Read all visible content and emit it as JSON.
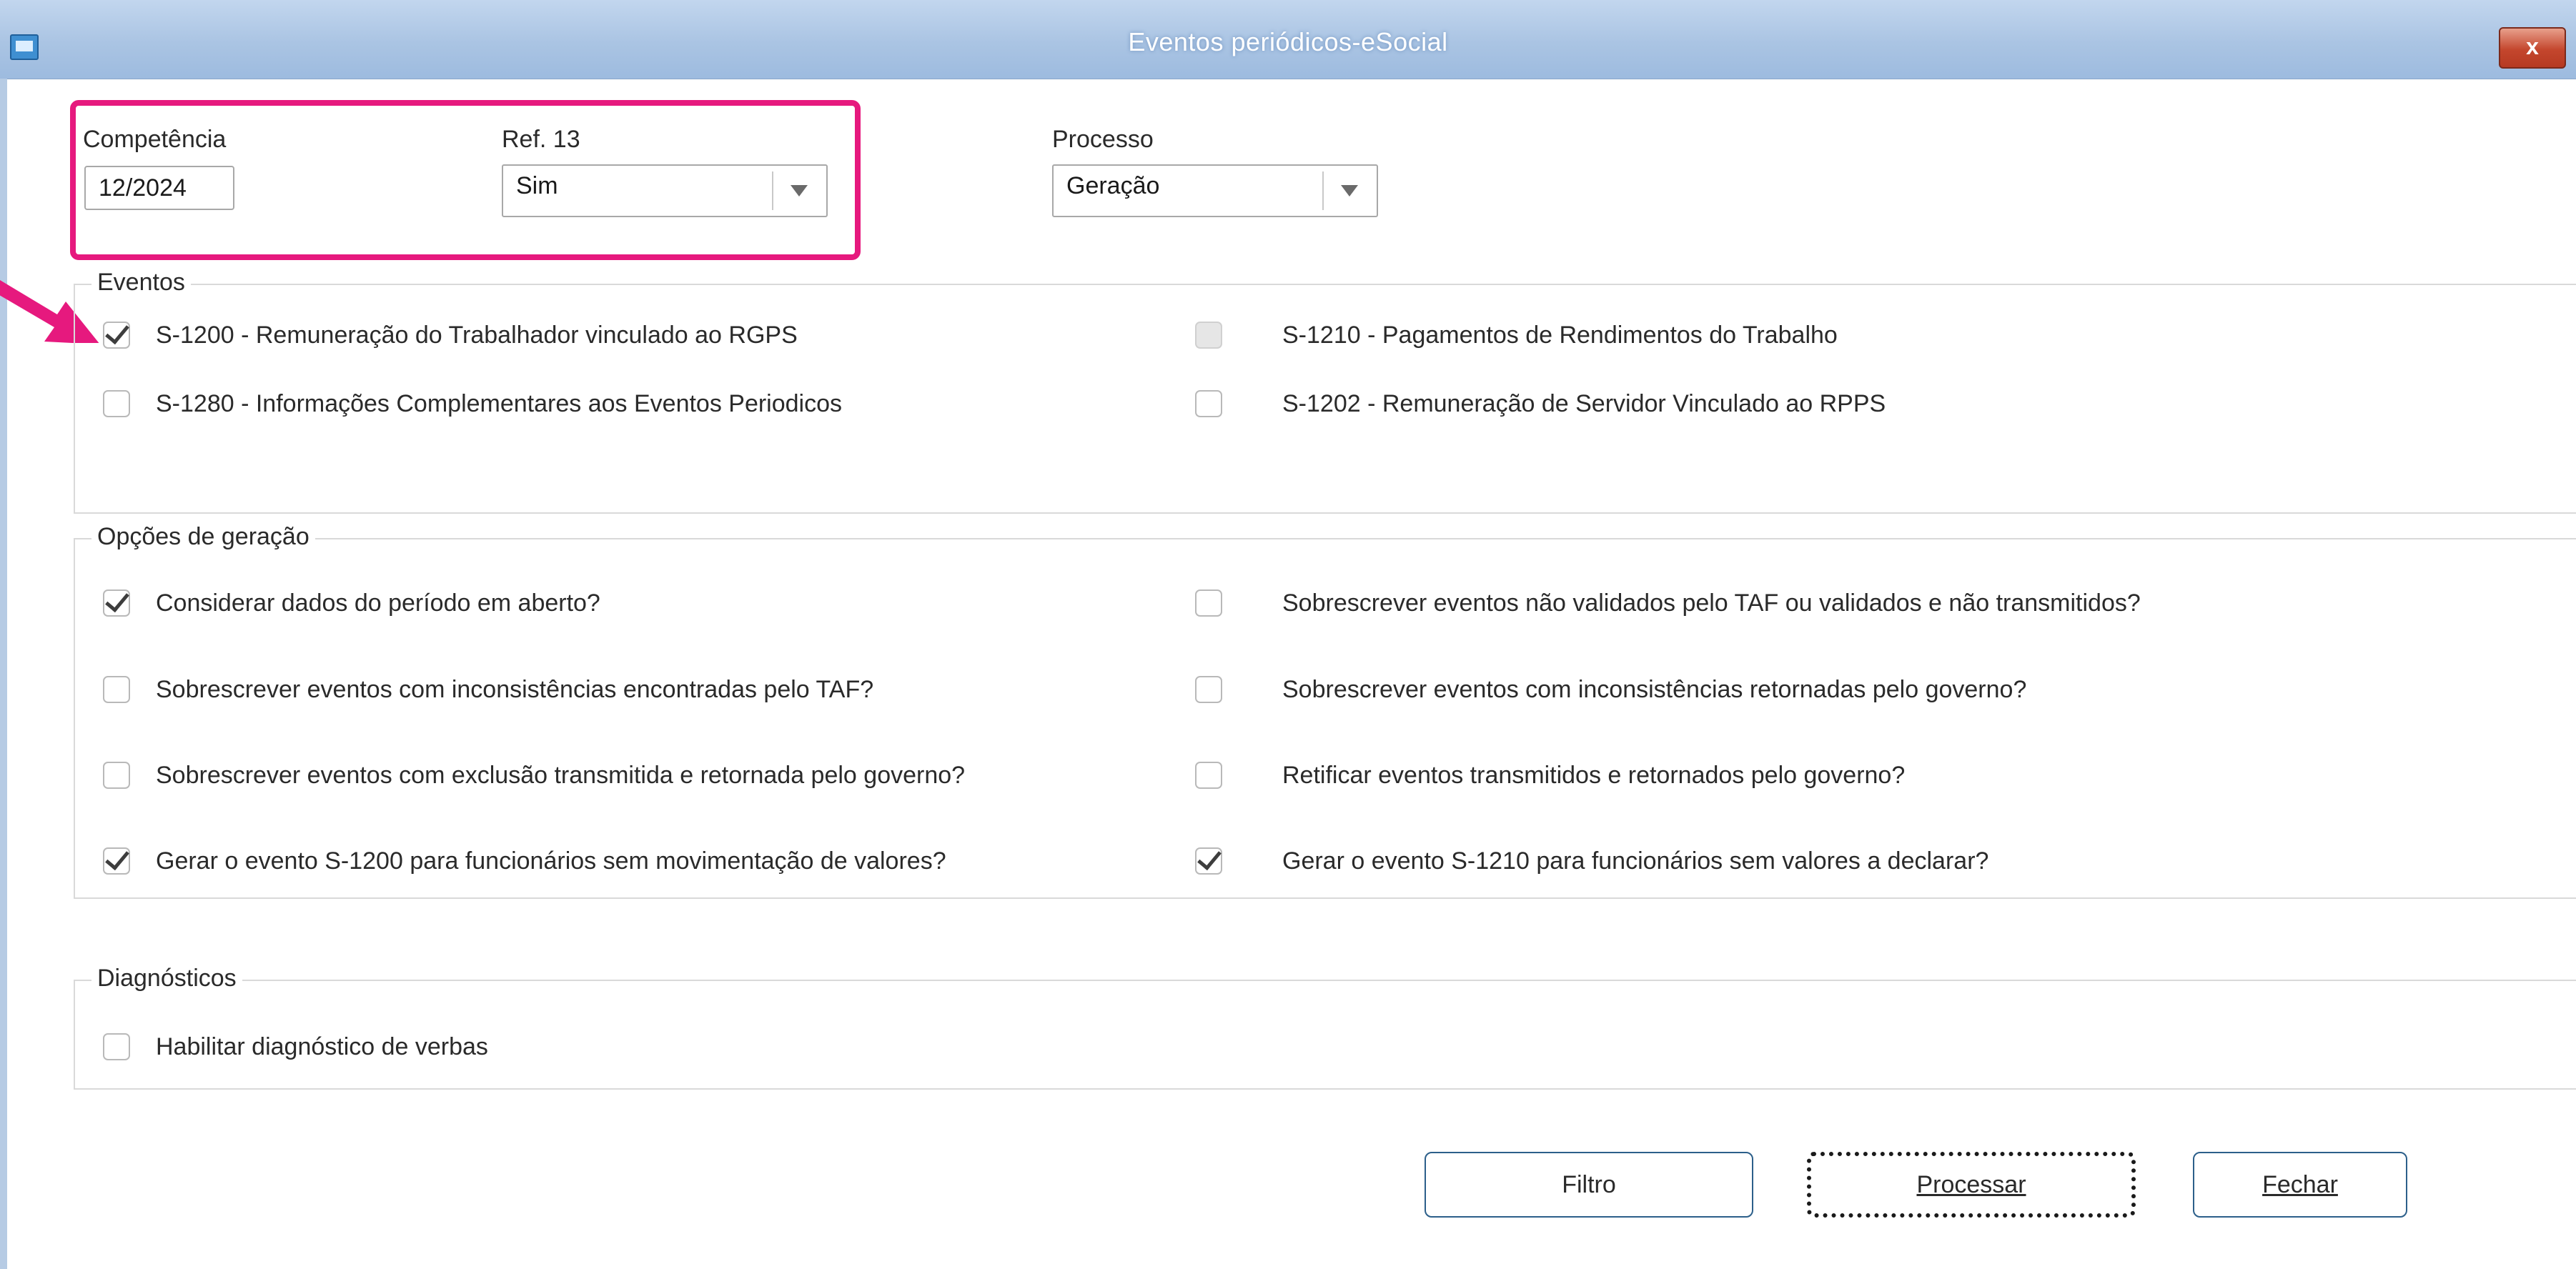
{
  "window": {
    "title": "Eventos periódicos-eSocial",
    "close_label": "x",
    "titlebar_color": "#aac4e3"
  },
  "header": {
    "competencia_label": "Competência",
    "competencia_value": "12/2024",
    "ref13_label": "Ref. 13",
    "ref13_value": "Sim",
    "processo_label": "Processo",
    "processo_value": "Geração",
    "highlight_color": "#e6197e"
  },
  "eventos": {
    "title": "Eventos",
    "items": [
      {
        "label": "S-1200 - Remuneração do Trabalhador vinculado ao RGPS",
        "checked": true,
        "disabled": false
      },
      {
        "label": "S-1210 - Pagamentos de Rendimentos do Trabalho",
        "checked": false,
        "disabled": true
      },
      {
        "label": "S-1280 - Informações Complementares aos Eventos Periodicos",
        "checked": false,
        "disabled": false
      },
      {
        "label": "S-1202 - Remuneração de Servidor Vinculado ao RPPS",
        "checked": false,
        "disabled": false
      }
    ]
  },
  "opcoes": {
    "title": "Opções de geração",
    "items": [
      {
        "label": "Considerar dados do período em aberto?",
        "checked": true
      },
      {
        "label": "Sobrescrever eventos não validados pelo TAF ou validados e não transmitidos?",
        "checked": false
      },
      {
        "label": "Sobrescrever eventos com inconsistências encontradas pelo TAF?",
        "checked": false
      },
      {
        "label": "Sobrescrever eventos com inconsistências retornadas pelo governo?",
        "checked": false
      },
      {
        "label": "Sobrescrever eventos com exclusão transmitida e retornada pelo governo?",
        "checked": false
      },
      {
        "label": "Retificar eventos transmitidos e retornados pelo governo?",
        "checked": false
      },
      {
        "label": "Gerar o evento S-1200 para funcionários sem movimentação de valores?",
        "checked": true
      },
      {
        "label": "Gerar o evento S-1210 para funcionários sem valores a declarar?",
        "checked": true
      }
    ]
  },
  "diagnosticos": {
    "title": "Diagnósticos",
    "items": [
      {
        "label": "Habilitar diagnóstico de verbas",
        "checked": false
      }
    ]
  },
  "buttons": {
    "filtro": "Filtro",
    "processar": "Processar",
    "fechar": "Fechar"
  },
  "annotation": {
    "arrow_color": "#e6197e"
  }
}
